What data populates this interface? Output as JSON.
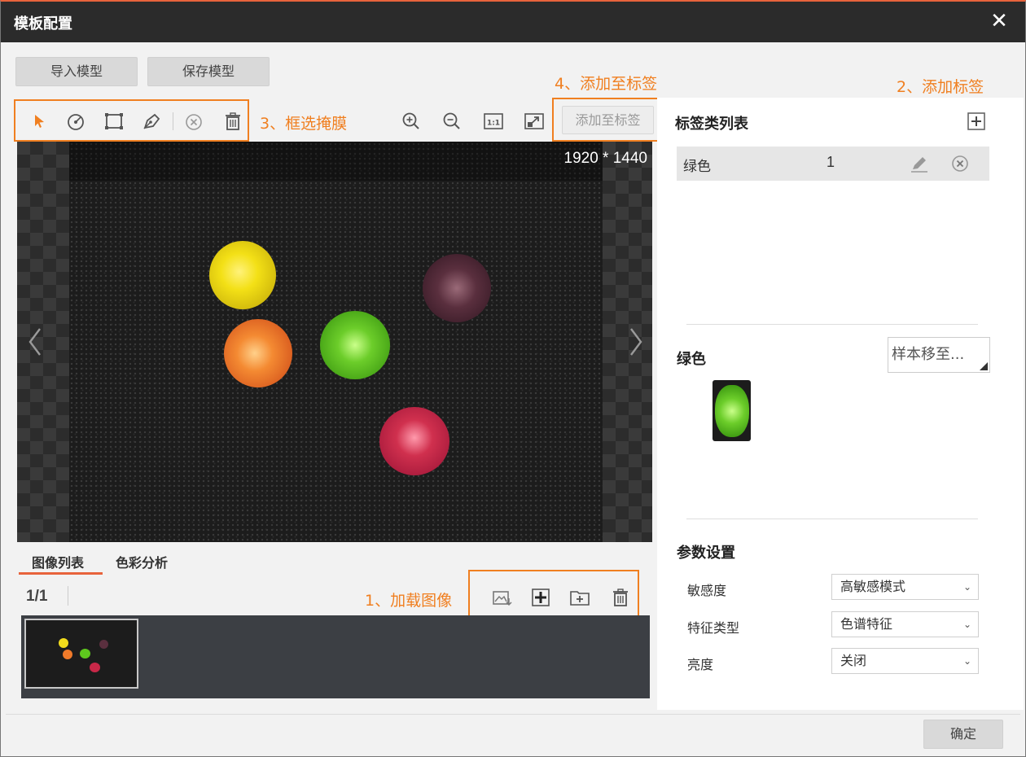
{
  "window": {
    "title": "模板配置",
    "close_glyph": "✕"
  },
  "toolbar_top": {
    "import_label": "导入模型",
    "save_label": "保存模型"
  },
  "annotations": {
    "add_to_label": "4、添加至标签",
    "add_label": "2、添加标签",
    "select_mask": "3、框选掩膜",
    "load_image": "1、加载图像"
  },
  "drawing_tools": [
    "pointer-icon",
    "circle-tool-icon",
    "rectangle-tool-icon",
    "pen-tool-icon",
    "clear-icon",
    "delete-icon"
  ],
  "view_tools": [
    "zoom-in-icon",
    "zoom-out-icon",
    "actual-size-icon",
    "fit-window-icon"
  ],
  "add_to_label_button": "添加至标签",
  "viewer": {
    "resolution": "1920 * 1440"
  },
  "bottom_tabs": {
    "image_list": "图像列表",
    "color_analysis": "色彩分析",
    "active": "图像列表"
  },
  "pagination": {
    "text": "1/1"
  },
  "image_list_tools": [
    "load-image-icon",
    "add-icon",
    "add-folder-icon",
    "delete-icon"
  ],
  "label_panel": {
    "title": "标签类列表",
    "labels": [
      {
        "name": "绿色",
        "count": "1"
      }
    ]
  },
  "selected_label": {
    "name": "绿色",
    "move_to": "样本移至..."
  },
  "params": {
    "title": "参数设置",
    "items": [
      {
        "label": "敏感度",
        "value": "高敏感模式"
      },
      {
        "label": "特征类型",
        "value": "色谱特征"
      },
      {
        "label": "亮度",
        "value": "关闭"
      }
    ]
  },
  "footer": {
    "ok_label": "确定"
  },
  "colors": {
    "accent": "#f07f20",
    "titlebar": "#2b2b2b",
    "tab_underline": "#e8633c"
  }
}
